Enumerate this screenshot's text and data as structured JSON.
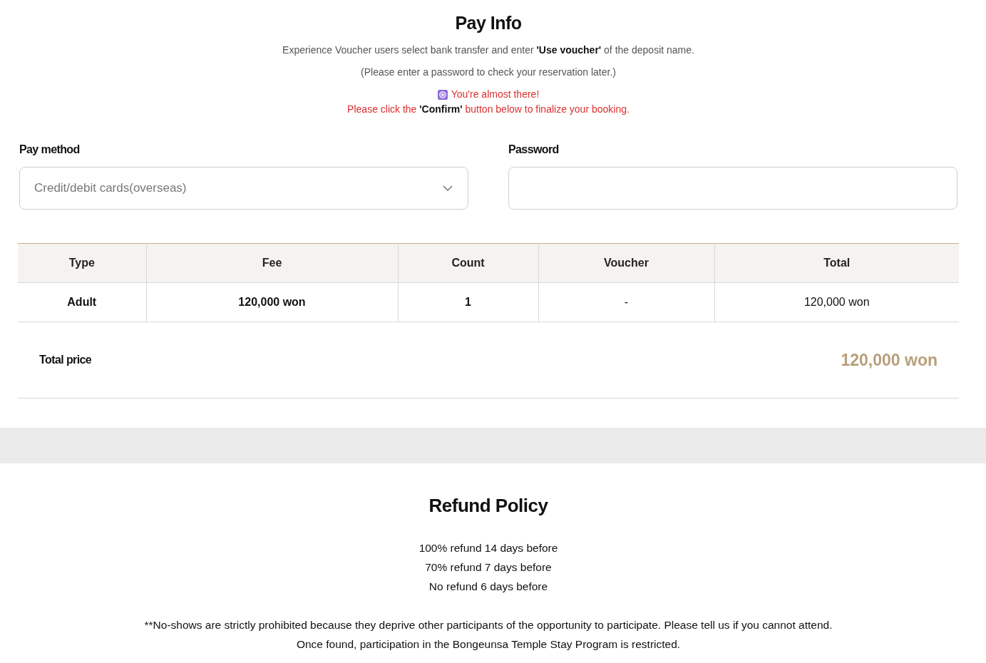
{
  "pay_info": {
    "title": "Pay Info",
    "notice": "Experience Voucher users select bank transfer and enter **'Use voucher'** of the deposit name.",
    "password_hint": "(Please enter a password to check your reservation later.)",
    "alert": {
      "message": "You're almost there!",
      "instruction": "Please click the **'Confirm'** button below to finalize your booking."
    }
  },
  "form": {
    "pay_method": {
      "label": "Pay method",
      "value": "Credit/debit cards(overseas)"
    },
    "password": {
      "label": "Password"
    }
  },
  "table": {
    "columns": [
      "Type",
      "Fee",
      "Count",
      "Voucher",
      "Total"
    ],
    "rows": [
      [
        "Adult",
        "120,000 won",
        "1",
        "-",
        "120,000 won"
      ]
    ]
  },
  "total_price": {
    "label": "Total price",
    "value": "120,000 won"
  },
  "refund_policy": {
    "title": "Refund Policy",
    "items": [
      "100% refund 14 days before",
      "70% refund 7 days before",
      "No refund 6 days before"
    ],
    "notes": [
      "**No-shows are strictly prohibited because they deprive other participants of the opportunity to participate. Please tell us if you cannot attend.",
      "Once found, participation in the Bongeunsa Temple Stay Program is restricted."
    ]
  }
}
